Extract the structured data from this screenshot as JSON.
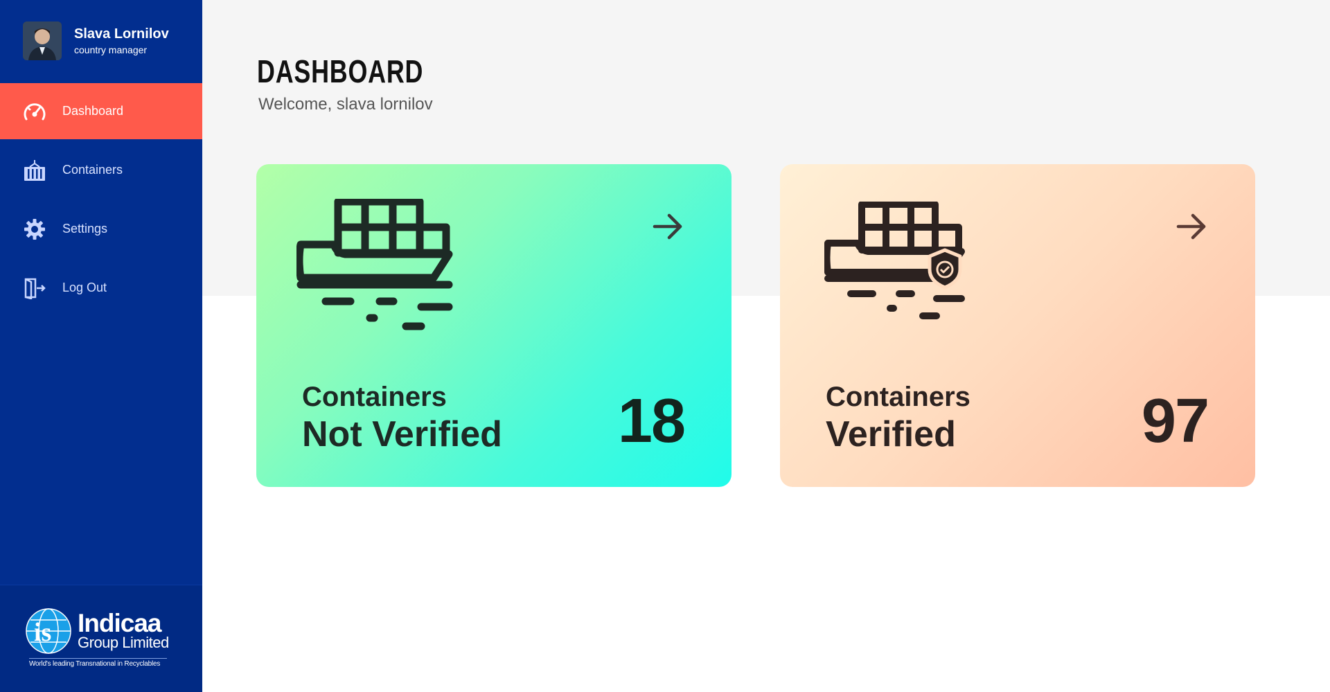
{
  "user": {
    "name": "Slava Lornilov",
    "role": "country manager"
  },
  "nav": {
    "items": [
      {
        "label": "Dashboard",
        "icon": "speedometer-icon"
      },
      {
        "label": "Containers",
        "icon": "container-icon"
      },
      {
        "label": "Settings",
        "icon": "gear-icon"
      },
      {
        "label": "Log Out",
        "icon": "logout-icon"
      }
    ]
  },
  "brand": {
    "logo_title": "Indicaa",
    "logo_sub": "Group Limited",
    "tagline": "World's leading Transnational in Recyclables"
  },
  "page": {
    "title": "DASHBOARD",
    "welcome": "Welcome, slava lornilov"
  },
  "cards": [
    {
      "line1": "Containers",
      "line2": "Not Verified",
      "count": "18",
      "icon": "cargo-ship-icon"
    },
    {
      "line1": "Containers",
      "line2": "Verified",
      "count": "97",
      "icon": "cargo-ship-verified-icon"
    }
  ],
  "colors": {
    "sidebar": "#022e8f",
    "active": "#ff5a4b",
    "card_green_start": "#b3ffa8",
    "card_green_end": "#20fbea",
    "card_peach_start": "#fff0d6",
    "card_peach_end": "#ffbfa3"
  }
}
